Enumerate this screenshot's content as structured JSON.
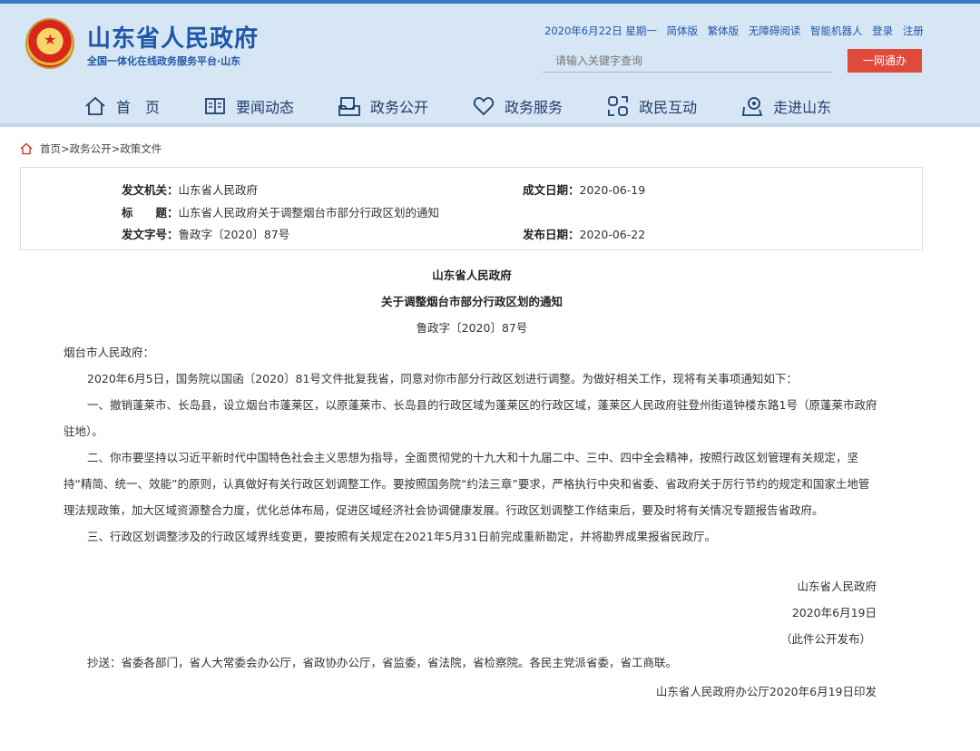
{
  "site": {
    "title": "山东省人民政府",
    "subtitle": "全国一体化在线政务服务平台·山东"
  },
  "topbar": {
    "date": "2020年6月22日 星期一",
    "links": [
      "简体版",
      "繁体版",
      "无障碍阅读",
      "智能机器人",
      "登录",
      "注册"
    ]
  },
  "search": {
    "placeholder": "请输入关键字查询",
    "button": "一网通办"
  },
  "nav": [
    {
      "label": "首　页",
      "icon": "home-icon"
    },
    {
      "label": "要闻动态",
      "icon": "book-icon"
    },
    {
      "label": "政务公开",
      "icon": "inbox-icon"
    },
    {
      "label": "政务服务",
      "icon": "heart-icon"
    },
    {
      "label": "政民互动",
      "icon": "chat-icon"
    },
    {
      "label": "走进山东",
      "icon": "map-icon"
    }
  ],
  "breadcrumb": "首页>政务公开>政策文件",
  "meta": {
    "issuer_label": "发文机关：",
    "issuer": "山东省人民政府",
    "date_label": "成文日期：",
    "date": "2020-06-19",
    "title_label": "标　　题：",
    "title": "山东省人民政府关于调整烟台市部分行政区划的通知",
    "number_label": "发文字号：",
    "number": "鲁政字〔2020〕87号",
    "publish_label": "发布日期：",
    "publish": "2020-06-22"
  },
  "doc": {
    "title1": "山东省人民政府",
    "title2": "关于调整烟台市部分行政区划的通知",
    "number": "鲁政字〔2020〕87号",
    "addressee": "烟台市人民政府：",
    "p1": "2020年6月5日，国务院以国函〔2020〕81号文件批复我省，同意对你市部分行政区划进行调整。为做好相关工作，现将有关事项通知如下：",
    "p2": "一、撤销蓬莱市、长岛县，设立烟台市蓬莱区，以原蓬莱市、长岛县的行政区域为蓬莱区的行政区域，蓬莱区人民政府驻登州街道钟楼东路1号（原蓬莱市政府驻地）。",
    "p3": "二、你市要坚持以习近平新时代中国特色社会主义思想为指导，全面贯彻党的十九大和十九届二中、三中、四中全会精神，按照行政区划管理有关规定，坚持“精简、统一、效能”的原则，认真做好有关行政区划调整工作。要按照国务院“约法三章”要求，严格执行中央和省委、省政府关于厉行节约的规定和国家土地管理法规政策，加大区域资源整合力度，优化总体布局，促进区域经济社会协调健康发展。行政区划调整工作结束后，要及时将有关情况专题报告省政府。",
    "p4": "三、行政区划调整涉及的行政区域界线变更，要按照有关规定在2021年5月31日前完成重新勘定，并将勘界成果报省民政厅。",
    "sign": "山东省人民政府",
    "sign_date": "2020年6月19日",
    "public_note": "（此件公开发布）",
    "cc": "抄送：省委各部门，省人大常委会办公厅，省政协办公厅，省监委，省法院，省检察院。各民主党派省委，省工商联。",
    "printed": "山东省人民政府办公厅2020年6月19日印发"
  }
}
